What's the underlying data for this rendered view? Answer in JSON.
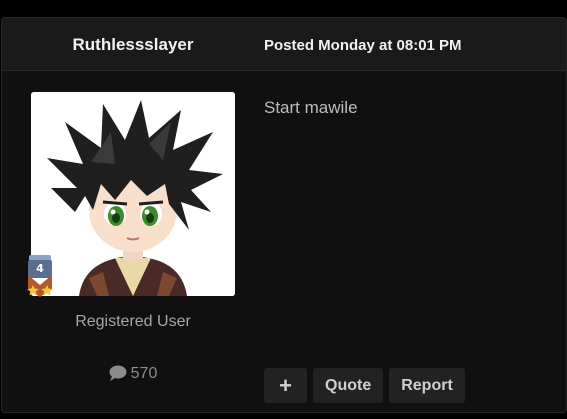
{
  "post": {
    "author": "Ruthlessslayer",
    "date": "Posted Monday at 08:01 PM",
    "user_title": "Registered User",
    "post_count": "570",
    "rank_level": "4",
    "content": "Start mawile",
    "actions": {
      "plus": "+",
      "quote": "Quote",
      "report": "Report"
    }
  },
  "icons": {
    "post_count_icon": "comment-icon",
    "rank_icon": "rank-badge-icon"
  },
  "colors": {
    "background": "#101010",
    "header": "#1a1a1a",
    "button": "#222222",
    "text": "#f2f2f2",
    "badge_gold": "#f5c542"
  }
}
